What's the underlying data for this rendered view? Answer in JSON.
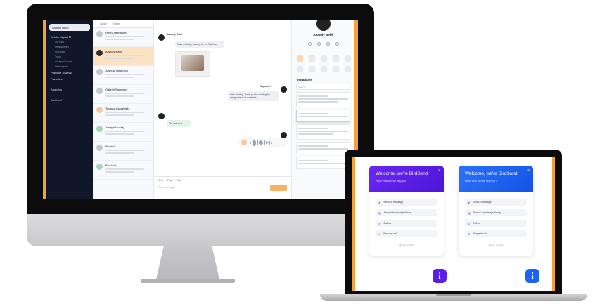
{
  "imac_app": {
    "sidebar": {
      "selector_label": "Sonnet Inbox",
      "groups": [
        {
          "label": "Aviator digital",
          "subs": [
            "On Hold",
            "Unanswered",
            "Snoozed",
            "Trash",
            "Assigned to me",
            "Unassigned"
          ]
        },
        {
          "label": "Principle Journal"
        },
        {
          "label": "Favorites"
        }
      ],
      "nav": [
        "Analytics",
        "Archived"
      ]
    },
    "list": {
      "tabs": [
        "Active",
        "Closed"
      ],
      "conversations": [
        {
          "name": "Henry Hernandez"
        },
        {
          "name": "Anatoly Belik"
        },
        {
          "name": "Joshua Tomlinson"
        },
        {
          "name": "Gabriel Sampson"
        },
        {
          "name": "Tomasz Kaszewski"
        },
        {
          "name": "Joseph Mosely"
        },
        {
          "name": "Ricardo"
        },
        {
          "name": "Ben Holt"
        }
      ]
    },
    "chat": {
      "contact_name": "Anatoly Belik",
      "messages": [
        "Make a Design concept for the first time",
        "Hello Anatoly. Thank you for sending the design sketch of a website.",
        "Ok, I will do it"
      ],
      "agent_name": "Rapunzel",
      "composer_tabs": [
        "Chat",
        "Email",
        "Note"
      ],
      "composer_placeholder": "Type a message..."
    },
    "panel": {
      "name": "Anatoly Belik",
      "templates_title": "Templates",
      "templates_search": "Search"
    }
  },
  "macbook_app": {
    "widgets": [
      {
        "title": "Welcome, we're BirdSend",
        "subtitle": "Hello! How can we help you?",
        "accent": "#5a1ee8",
        "options": [
          {
            "icon": "chat-icon",
            "label": "Send us message"
          },
          {
            "icon": "book-icon",
            "label": "Search knowledge library"
          },
          {
            "icon": "phone-icon",
            "label": "Call us"
          },
          {
            "icon": "callback-icon",
            "label": "Request call"
          }
        ],
        "footer": "We run on Tidio"
      },
      {
        "title": "Welcome, we're BirdSend",
        "subtitle": "Hello! How can we help you?",
        "accent": "#1a63f5",
        "options": [
          {
            "icon": "chat-icon",
            "label": "Send a message"
          },
          {
            "icon": "book-icon",
            "label": "Search knowledge library"
          },
          {
            "icon": "phone-icon",
            "label": "Call us"
          },
          {
            "icon": "callback-icon",
            "label": "Request call"
          }
        ],
        "footer": "We run on Tidio"
      }
    ],
    "fab_label": "i",
    "fab_colors": [
      "#5a1ee8",
      "#1a63f5"
    ]
  }
}
